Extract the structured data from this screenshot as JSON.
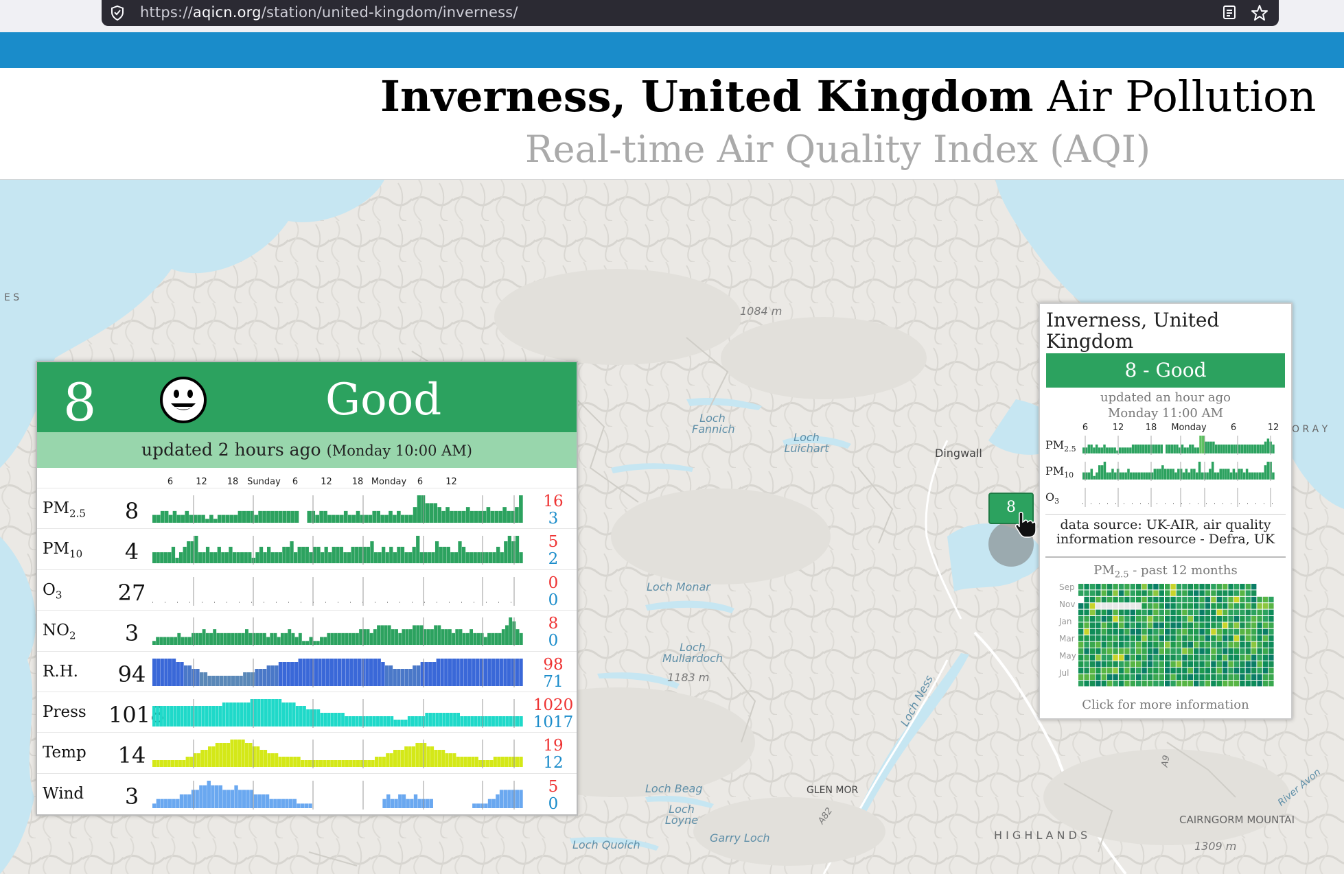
{
  "browser": {
    "url_prefix": "https://",
    "url_domain": "aqicn.org",
    "url_path": "/station/united-kingdom/inverness/"
  },
  "header": {
    "title_place": "Inverness, United Kingdom",
    "title_rest": "Air Pollution",
    "subtitle": "Real-time Air Quality Index (AQI)"
  },
  "map_labels": [
    {
      "text": "1084 m",
      "class": "grey"
    },
    {
      "text": "Loch Fannich",
      "class": ""
    },
    {
      "text": "Loch Luichart",
      "class": ""
    },
    {
      "text": "Dingwall",
      "class": "dark"
    },
    {
      "text": "Loch Monar",
      "class": ""
    },
    {
      "text": "Loch Mullardoch",
      "class": ""
    },
    {
      "text": "1183 m",
      "class": "grey"
    },
    {
      "text": "Loch Ness",
      "class": ""
    },
    {
      "text": "Loch Beag",
      "class": ""
    },
    {
      "text": "GLEN MOR",
      "class": "dark"
    },
    {
      "text": "Loch Loyne",
      "class": ""
    },
    {
      "text": "Garry Loch",
      "class": ""
    },
    {
      "text": "Loch Quoich",
      "class": ""
    },
    {
      "text": "H I G H L A N D S",
      "class": "dark"
    },
    {
      "text": "CAIRNGORM MOUNTAI",
      "class": "dark"
    },
    {
      "text": "1309 m",
      "class": "grey"
    },
    {
      "text": "A9",
      "class": "grey"
    },
    {
      "text": "A82",
      "class": "grey"
    },
    {
      "text": "River Avon",
      "class": ""
    },
    {
      "text": "E S",
      "class": "dark"
    },
    {
      "text": "O R A Y",
      "class": "dark"
    }
  ],
  "aqi_widget": {
    "value": "8",
    "level": "Good",
    "updated": "updated 2 hours ago",
    "updated_time": "(Monday 10:00 AM)",
    "colors": {
      "good": "#2ca25f",
      "updated_bg": "#98d6ac",
      "max": "#e33333",
      "min": "#1a8cca"
    },
    "hour_scale": [
      "6",
      "12",
      "18",
      "Sunday",
      "6",
      "12",
      "18",
      "Monday",
      "6",
      "12"
    ],
    "rows": [
      {
        "name": "PM",
        "sub": "2.5",
        "value": "8",
        "max": "16",
        "min": "3",
        "color": "#2ca25f",
        "series": [
          2,
          2,
          3,
          3,
          2,
          3,
          2,
          2,
          3,
          2,
          2,
          2,
          2,
          1,
          2,
          1,
          2,
          2,
          2,
          2,
          2,
          3,
          3,
          3,
          3,
          2,
          3,
          3,
          3,
          3,
          3,
          3,
          3,
          3,
          3,
          3,
          0,
          0,
          3,
          3,
          2,
          3,
          3,
          2,
          2,
          2,
          2,
          3,
          2,
          2,
          3,
          2,
          2,
          2,
          3,
          3,
          2,
          2,
          3,
          2,
          3,
          2,
          2,
          2,
          4,
          7,
          7,
          5,
          5,
          5,
          4,
          3,
          4,
          3,
          3,
          3,
          3,
          4,
          3,
          3,
          3,
          3,
          4,
          3,
          3,
          3,
          4,
          3,
          3,
          4,
          7
        ]
      },
      {
        "name": "PM",
        "sub": "10",
        "value": "4",
        "max": "5",
        "min": "2",
        "color": "#2ca25f",
        "series": [
          2,
          2,
          2,
          2,
          2,
          3,
          1,
          2,
          3,
          4,
          4,
          5,
          2,
          2,
          3,
          2,
          2,
          3,
          2,
          2,
          3,
          2,
          2,
          2,
          2,
          2,
          1,
          2,
          3,
          2,
          3,
          2,
          2,
          2,
          3,
          3,
          4,
          2,
          3,
          3,
          3,
          2,
          3,
          3,
          2,
          3,
          2,
          3,
          3,
          3,
          2,
          2,
          3,
          3,
          3,
          3,
          3,
          4,
          2,
          2,
          3,
          2,
          3,
          2,
          3,
          3,
          2,
          2,
          3,
          5,
          2,
          2,
          2,
          2,
          4,
          3,
          3,
          3,
          2,
          2,
          4,
          3,
          2,
          2,
          2,
          2,
          2,
          2,
          2,
          2,
          3,
          2,
          4,
          5,
          4,
          5,
          2
        ]
      },
      {
        "name": "O",
        "sub": "3",
        "value": "27",
        "max": "0",
        "min": "0",
        "color": "#999999",
        "series": []
      },
      {
        "name": "NO",
        "sub": "2",
        "value": "3",
        "max": "8",
        "min": "0",
        "color": "#2ca25f",
        "series": [
          1,
          2,
          2,
          2,
          2,
          2,
          2,
          3,
          2,
          2,
          2,
          3,
          3,
          3,
          4,
          3,
          3,
          4,
          3,
          3,
          3,
          3,
          3,
          3,
          3,
          3,
          4,
          3,
          3,
          3,
          3,
          3,
          2,
          3,
          3,
          2,
          3,
          3,
          4,
          3,
          2,
          3,
          1,
          1,
          2,
          1,
          1,
          2,
          2,
          3,
          3,
          3,
          3,
          3,
          3,
          3,
          3,
          3,
          4,
          4,
          4,
          3,
          4,
          5,
          5,
          5,
          5,
          4,
          4,
          3,
          4,
          4,
          4,
          5,
          5,
          5,
          4,
          4,
          4,
          5,
          5,
          4,
          4,
          4,
          3,
          4,
          4,
          3,
          3,
          4,
          3,
          3,
          3,
          2,
          3,
          3,
          3,
          3,
          4,
          5,
          7,
          6,
          4,
          3
        ]
      },
      {
        "name": "R.H.",
        "sub": "",
        "value": "94",
        "max": "98",
        "min": "71",
        "color": "#3a68c8",
        "series": [
          8,
          8,
          8,
          8,
          8,
          8,
          7,
          7,
          6,
          6,
          5,
          5,
          4,
          4,
          3,
          3,
          3,
          3,
          3,
          3,
          3,
          3,
          3,
          4,
          4,
          4,
          5,
          5,
          5,
          6,
          6,
          6,
          7,
          7,
          7,
          7,
          7,
          8,
          8,
          8,
          8,
          8,
          8,
          8,
          8,
          8,
          8,
          8,
          8,
          8,
          8,
          8,
          8,
          8,
          8,
          8,
          8,
          8,
          7,
          6,
          6,
          5,
          5,
          5,
          5,
          5,
          6,
          6,
          7,
          7,
          7,
          7,
          8,
          8,
          8,
          8,
          8,
          8,
          8,
          8,
          8,
          8,
          8,
          8,
          8,
          8,
          8,
          8,
          8,
          8,
          8,
          8,
          8,
          8
        ]
      },
      {
        "name": "Press",
        "sub": "",
        "value": "1018",
        "max": "1020",
        "min": "1017",
        "color": "#1fd9c9",
        "series": [
          6,
          6,
          6,
          6,
          6,
          6,
          6,
          6,
          6,
          6,
          6,
          6,
          6,
          6,
          6,
          6,
          6,
          6,
          6,
          6,
          7,
          7,
          7,
          7,
          7,
          7,
          7,
          7,
          8,
          8,
          8,
          8,
          8,
          8,
          8,
          8,
          8,
          7,
          7,
          7,
          7,
          6,
          6,
          6,
          5,
          5,
          5,
          5,
          4,
          4,
          4,
          4,
          4,
          4,
          4,
          3,
          3,
          3,
          3,
          3,
          3,
          3,
          3,
          3,
          3,
          3,
          3,
          3,
          3,
          2,
          2,
          2,
          2,
          3,
          3,
          3,
          3,
          3,
          4,
          4,
          4,
          4,
          4,
          4,
          4,
          4,
          4,
          4,
          3,
          3,
          3,
          3,
          3,
          3,
          3,
          3,
          3,
          3,
          3,
          3,
          3,
          3,
          3,
          3,
          3,
          3
        ]
      },
      {
        "name": "Temp",
        "sub": "",
        "value": "14",
        "max": "19",
        "min": "12",
        "color": "#d4e818",
        "series": [
          2,
          2,
          2,
          2,
          2,
          2,
          2,
          2,
          2,
          3,
          3,
          4,
          4,
          5,
          5,
          6,
          6,
          7,
          7,
          7,
          7,
          8,
          8,
          8,
          8,
          7,
          7,
          6,
          6,
          5,
          5,
          4,
          4,
          4,
          3,
          3,
          3,
          3,
          3,
          3,
          2,
          2,
          2,
          2,
          2,
          2,
          2,
          2,
          2,
          2,
          2,
          2,
          2,
          2,
          2,
          2,
          2,
          2,
          2,
          2,
          3,
          3,
          3,
          4,
          4,
          5,
          5,
          5,
          6,
          6,
          6,
          7,
          7,
          7,
          6,
          6,
          5,
          5,
          5,
          4,
          4,
          4,
          3,
          3,
          3,
          3,
          3,
          3,
          2,
          2,
          2,
          2,
          3,
          3,
          3,
          3,
          3,
          3,
          3,
          3
        ]
      },
      {
        "name": "Wind",
        "sub": "",
        "value": "3",
        "max": "5",
        "min": "0",
        "color": "#6aa8f0",
        "series": [
          1,
          2,
          2,
          2,
          2,
          2,
          2,
          3,
          3,
          3,
          4,
          4,
          5,
          5,
          6,
          5,
          5,
          5,
          4,
          4,
          4,
          5,
          4,
          4,
          4,
          4,
          3,
          3,
          3,
          3,
          2,
          2,
          2,
          2,
          2,
          2,
          2,
          1,
          1,
          1,
          1,
          0,
          0,
          0,
          0,
          0,
          0,
          0,
          0,
          0,
          0,
          0,
          0,
          0,
          0,
          0,
          0,
          0,
          0,
          2,
          3,
          2,
          2,
          3,
          3,
          2,
          2,
          3,
          2,
          2,
          2,
          2,
          0,
          0,
          0,
          0,
          0,
          0,
          0,
          0,
          0,
          0,
          1,
          1,
          1,
          1,
          2,
          2,
          3,
          4,
          4,
          4,
          4,
          4,
          4
        ]
      }
    ]
  },
  "popup": {
    "title": "Inverness, United Kingdom",
    "aqi": "8 - Good",
    "updated": "updated an hour ago",
    "updated_time": "Monday 11:00 AM",
    "hour_scale": [
      "6",
      "12",
      "18",
      "Monday",
      "6",
      "12"
    ],
    "rows": [
      {
        "name": "PM",
        "sub": "2.5",
        "series": [
          2,
          2,
          3,
          3,
          2,
          3,
          2,
          2,
          3,
          2,
          2,
          2,
          2,
          1,
          2,
          2,
          2,
          2,
          2,
          3,
          3,
          3,
          3,
          3,
          3,
          3,
          3,
          3,
          3,
          3,
          3,
          0,
          3,
          3,
          3,
          3,
          3,
          2,
          3,
          2,
          2,
          3,
          3,
          2,
          2,
          6,
          6,
          4,
          4,
          4,
          4,
          3,
          3,
          3,
          3,
          3,
          3,
          3,
          3,
          3,
          3,
          3,
          3,
          3,
          3,
          3,
          3,
          3,
          3,
          3,
          4,
          5,
          4,
          3
        ]
      },
      {
        "name": "PM",
        "sub": "10",
        "series": [
          2,
          2,
          2,
          3,
          1,
          2,
          4,
          4,
          5,
          2,
          2,
          3,
          2,
          3,
          2,
          2,
          2,
          3,
          2,
          2,
          2,
          2,
          2,
          2,
          2,
          2,
          2,
          3,
          3,
          3,
          4,
          3,
          3,
          3,
          3,
          2,
          3,
          3,
          2,
          3,
          2,
          3,
          3,
          2,
          5,
          2,
          2,
          2,
          3,
          5,
          2,
          2,
          3,
          3,
          3,
          3,
          2,
          3,
          2,
          3,
          3,
          2,
          3,
          2,
          2,
          2,
          2,
          2,
          2,
          4,
          5,
          5,
          2
        ]
      },
      {
        "name": "O",
        "sub": "3",
        "series": []
      }
    ],
    "source": "data source: UK-AIR, air quality information resource - Defra, UK",
    "history_label": "PM",
    "history_sub": "2.5",
    "history_suffix": " - past 12 months",
    "months": [
      "Sep",
      "Nov",
      "Jan",
      "Mar",
      "May",
      "Jul"
    ],
    "click": "Click for more information"
  },
  "marker": {
    "value": "8",
    "color": "#2ca25f"
  }
}
